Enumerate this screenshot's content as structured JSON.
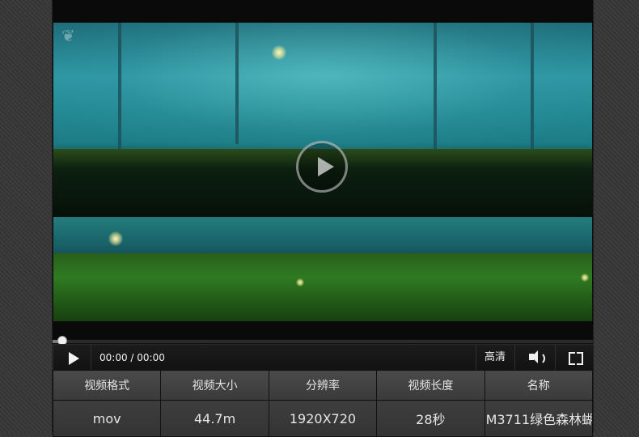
{
  "player": {
    "time_display": "00:00 / 00:00",
    "progress_fraction": 0.0,
    "quality_label": "高清",
    "icons": {
      "play": "play-icon",
      "big_play": "play-circle-icon",
      "volume": "volume-icon",
      "fullscreen": "fullscreen-icon"
    }
  },
  "info_table": {
    "headers": [
      "视频格式",
      "视频大小",
      "分辨率",
      "视频长度",
      "名称"
    ],
    "values": [
      "mov",
      "44.7m",
      "1920X720",
      "28秒",
      "M3711绿色森林蝴"
    ]
  },
  "colors": {
    "background": "#3a3a3a",
    "player_bg": "#101010",
    "table_cell": "#3a3a3a",
    "text": "#e6e6e6"
  }
}
